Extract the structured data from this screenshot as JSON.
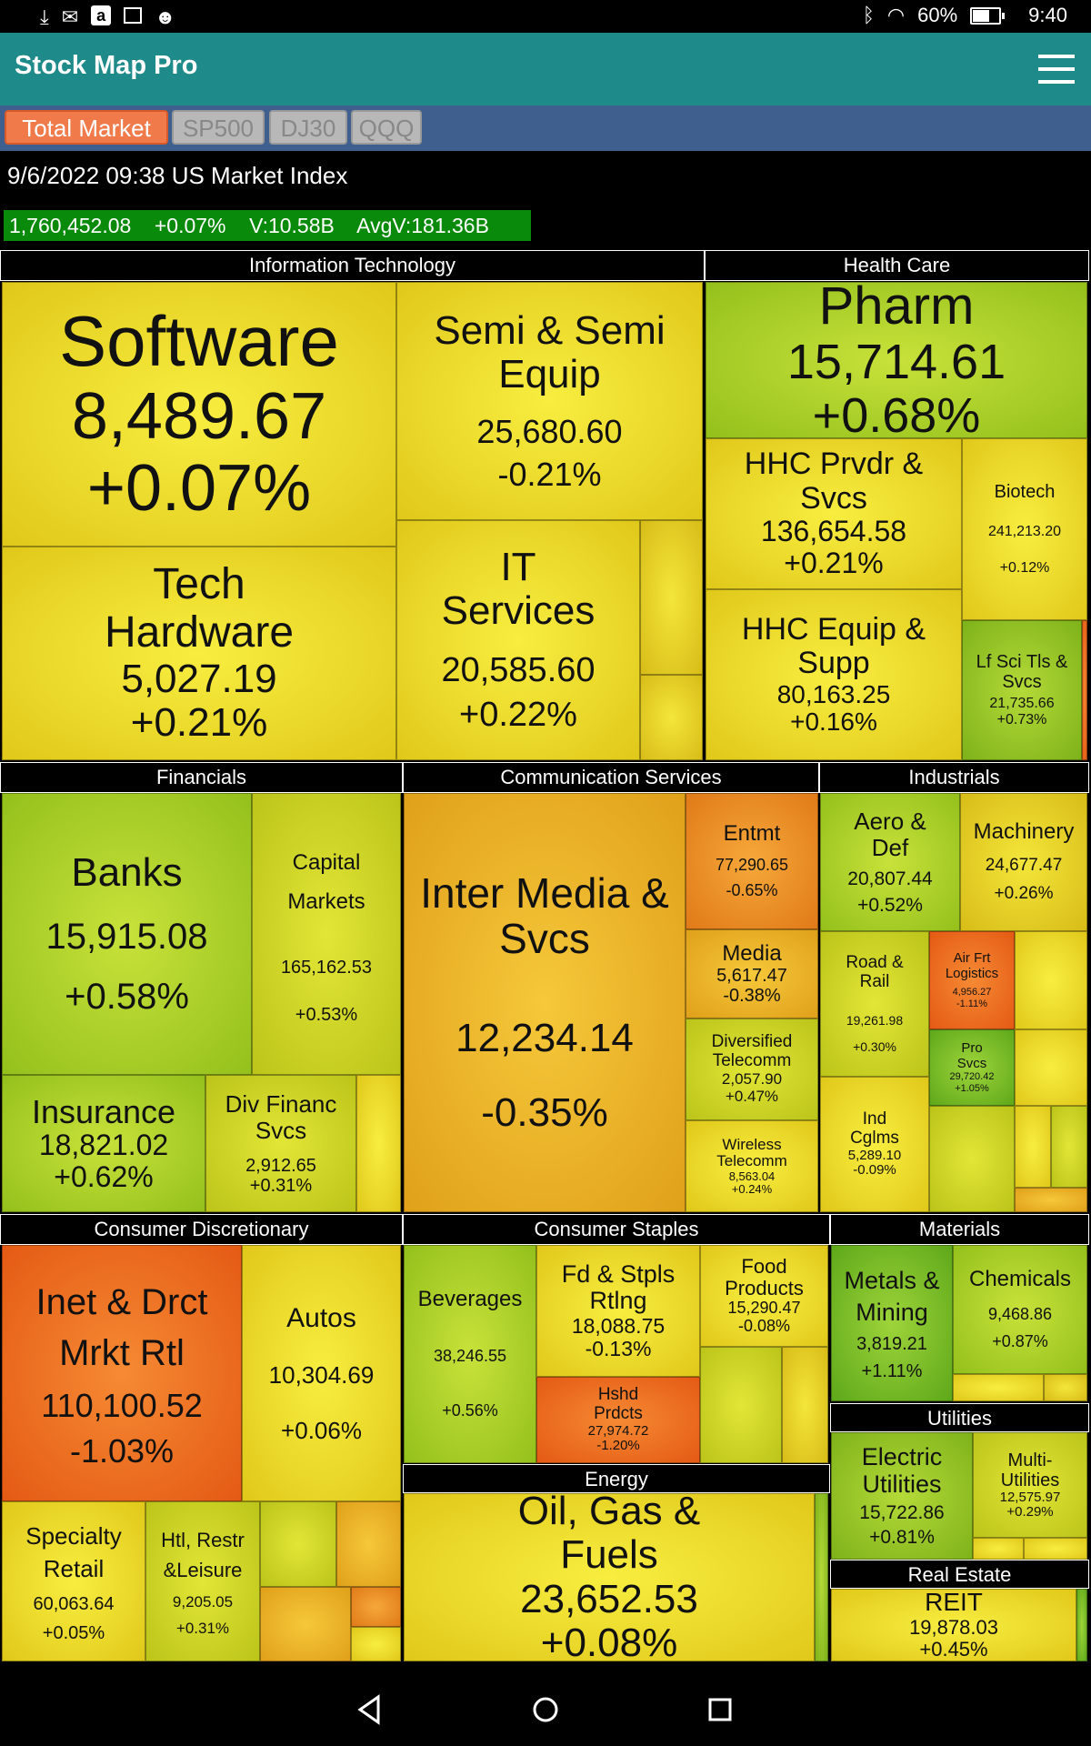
{
  "status_bar": {
    "battery_percent": "60%",
    "time": "9:40",
    "icons": [
      "download-icon",
      "mail-icon",
      "amazon-icon",
      "image-icon",
      "android-icon",
      "bluetooth-icon",
      "wifi-icon",
      "battery-icon"
    ]
  },
  "app": {
    "title": "Stock Map Pro"
  },
  "tabs": [
    {
      "label": "Total Market",
      "active": true
    },
    {
      "label": "SP500",
      "active": false
    },
    {
      "label": "DJ30",
      "active": false
    },
    {
      "label": "QQQ",
      "active": false
    }
  ],
  "index": {
    "heading": "9/6/2022 09:38 US Market Index",
    "value": "1,760,452.08",
    "change": "+0.07%",
    "volume": "V:10.58B",
    "avg_volume": "AvgV:181.36B"
  },
  "sectors": {
    "info_tech": "Information Technology",
    "health_care": "Health Care",
    "financials": "Financials",
    "comm_services": "Communication Services",
    "industrials": "Industrials",
    "consumer_disc": "Consumer Discretionary",
    "consumer_staples": "Consumer Staples",
    "materials": "Materials",
    "utilities": "Utilities",
    "energy": "Energy",
    "real_estate": "Real Estate"
  },
  "tiles": {
    "software": {
      "name": "Software",
      "value": "8,489.67",
      "change": "+0.07%"
    },
    "semi": {
      "name": "Semi & Semi Equip",
      "value": "25,680.60",
      "change": "-0.21%"
    },
    "tech_hw": {
      "name": "Tech Hardware",
      "value": "5,027.19",
      "change": "+0.21%"
    },
    "it_services": {
      "name": "IT Services",
      "value": "20,585.60",
      "change": "+0.22%"
    },
    "pharm": {
      "name": "Pharm",
      "value": "15,714.61",
      "change": "+0.68%"
    },
    "hhc_prvdr": {
      "name": "HHC Prvdr & Svcs",
      "value": "136,654.58",
      "change": "+0.21%"
    },
    "biotech": {
      "name": "Biotech",
      "value": "241,213.20",
      "change": "+0.12%"
    },
    "hhc_equip": {
      "name": "HHC Equip & Supp",
      "value": "80,163.25",
      "change": "+0.16%"
    },
    "lf_sci": {
      "name": "Lf Sci Tls & Svcs",
      "value": "21,735.66",
      "change": "+0.73%"
    },
    "banks": {
      "name": "Banks",
      "value": "15,915.08",
      "change": "+0.58%"
    },
    "cap_markets": {
      "name": "Capital Markets",
      "value": "165,162.53",
      "change": "+0.53%"
    },
    "insurance": {
      "name": "Insurance",
      "value": "18,821.02",
      "change": "+0.62%"
    },
    "div_financ": {
      "name": "Div Financ Svcs",
      "value": "2,912.65",
      "change": "+0.31%"
    },
    "inter_media": {
      "name": "Inter Media & Svcs",
      "value": "12,234.14",
      "change": "-0.35%"
    },
    "entmt": {
      "name": "Entmt",
      "value": "77,290.65",
      "change": "-0.65%"
    },
    "media": {
      "name": "Media",
      "value": "5,617.47",
      "change": "-0.38%"
    },
    "div_telecom": {
      "name": "Diversified Telecomm",
      "value": "2,057.90",
      "change": "+0.47%"
    },
    "wireless": {
      "name": "Wireless Telecomm",
      "value": "8,563.04",
      "change": "+0.24%"
    },
    "aero": {
      "name": "Aero & Def",
      "value": "20,807.44",
      "change": "+0.52%"
    },
    "machinery": {
      "name": "Machinery",
      "value": "24,677.47",
      "change": "+0.26%"
    },
    "road_rail": {
      "name": "Road & Rail",
      "value": "19,261.98",
      "change": "+0.30%"
    },
    "air_frt": {
      "name": "Air Frt Logistics",
      "value": "4,956.27",
      "change": "-1.11%"
    },
    "pro_svcs": {
      "name": "Pro Svcs",
      "value": "29,720.42",
      "change": "+1.05%"
    },
    "ind_cglms": {
      "name": "Ind Cglms",
      "value": "5,289.10",
      "change": "-0.09%"
    },
    "inet_rtl": {
      "name": "Inet & Drct Mrkt Rtl",
      "value": "110,100.52",
      "change": "-1.03%"
    },
    "autos": {
      "name": "Autos",
      "value": "10,304.69",
      "change": "+0.06%"
    },
    "specialty": {
      "name": "Specialty Retail",
      "value": "60,063.64",
      "change": "+0.05%"
    },
    "htl": {
      "name": "Htl, Restr &Leisure",
      "value": "9,205.05",
      "change": "+0.31%"
    },
    "beverages": {
      "name": "Beverages",
      "value": "38,246.55",
      "change": "+0.56%"
    },
    "fd_stpls": {
      "name": "Fd & Stpls Rtlng",
      "value": "18,088.75",
      "change": "-0.13%"
    },
    "food_prod": {
      "name": "Food Products",
      "value": "15,290.47",
      "change": "-0.08%"
    },
    "hshd": {
      "name": "Hshd Prdcts",
      "value": "27,974.72",
      "change": "-1.20%"
    },
    "metals": {
      "name": "Metals & Mining",
      "value": "3,819.21",
      "change": "+1.11%"
    },
    "chemicals": {
      "name": "Chemicals",
      "value": "9,468.86",
      "change": "+0.87%"
    },
    "elec_util": {
      "name": "Electric Utilities",
      "value": "15,722.86",
      "change": "+0.81%"
    },
    "multi_util": {
      "name": "Multi-Utilities",
      "value": "12,575.97",
      "change": "+0.29%"
    },
    "oil_gas": {
      "name": "Oil, Gas & Fuels",
      "value": "23,652.53",
      "change": "+0.08%"
    },
    "reit": {
      "name": "REIT",
      "value": "19,878.03",
      "change": "+0.45%"
    }
  }
}
